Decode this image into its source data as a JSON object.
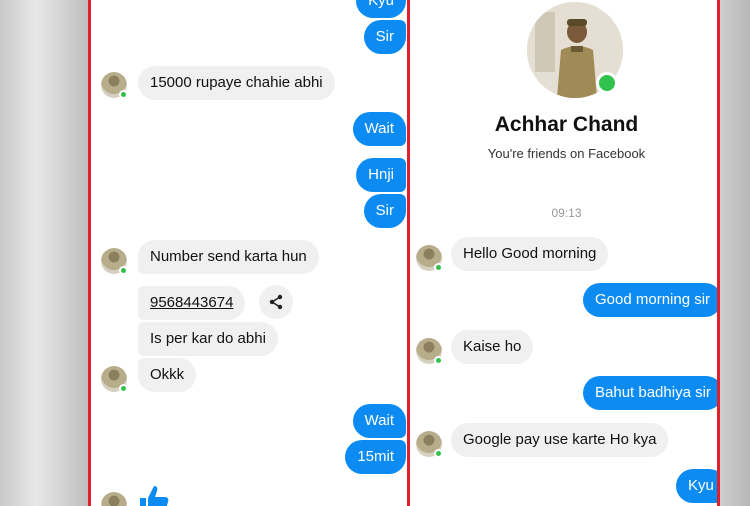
{
  "left": {
    "messages": [
      {
        "text": "Kyu",
        "dir": "out"
      },
      {
        "text": "Sir",
        "dir": "out"
      },
      {
        "text": "15000 rupaye chahie abhi",
        "dir": "in"
      },
      {
        "text": "Wait",
        "dir": "out"
      },
      {
        "text": "Hnji",
        "dir": "out"
      },
      {
        "text": "Sir",
        "dir": "out"
      },
      {
        "text": "Number send karta hun",
        "dir": "in"
      },
      {
        "text": "9568443674",
        "dir": "in"
      },
      {
        "text": "Is per kar do abhi",
        "dir": "in"
      },
      {
        "text": "Okkk",
        "dir": "in"
      },
      {
        "text": "Wait",
        "dir": "out"
      },
      {
        "text": "15mit",
        "dir": "out"
      }
    ]
  },
  "right": {
    "profile_name": "Achhar Chand",
    "friends_text": "You're friends on Facebook",
    "timestamp": "09:13",
    "messages": [
      {
        "text": "Hello Good morning",
        "dir": "in"
      },
      {
        "text": "Good morning sir",
        "dir": "out"
      },
      {
        "text": "Kaise ho",
        "dir": "in"
      },
      {
        "text": "Bahut badhiya sir",
        "dir": "out"
      },
      {
        "text": "Google pay use karte Ho kya",
        "dir": "in"
      },
      {
        "text": "Kyu",
        "dir": "out"
      }
    ]
  },
  "colors": {
    "outgoing": "#0c8cf2",
    "incoming": "#f0f0f0",
    "border": "#e0202a",
    "online": "#31c24d"
  },
  "icons": [
    "avatar",
    "online-dot",
    "share-icon",
    "thumbs-up-icon",
    "profile-photo"
  ]
}
